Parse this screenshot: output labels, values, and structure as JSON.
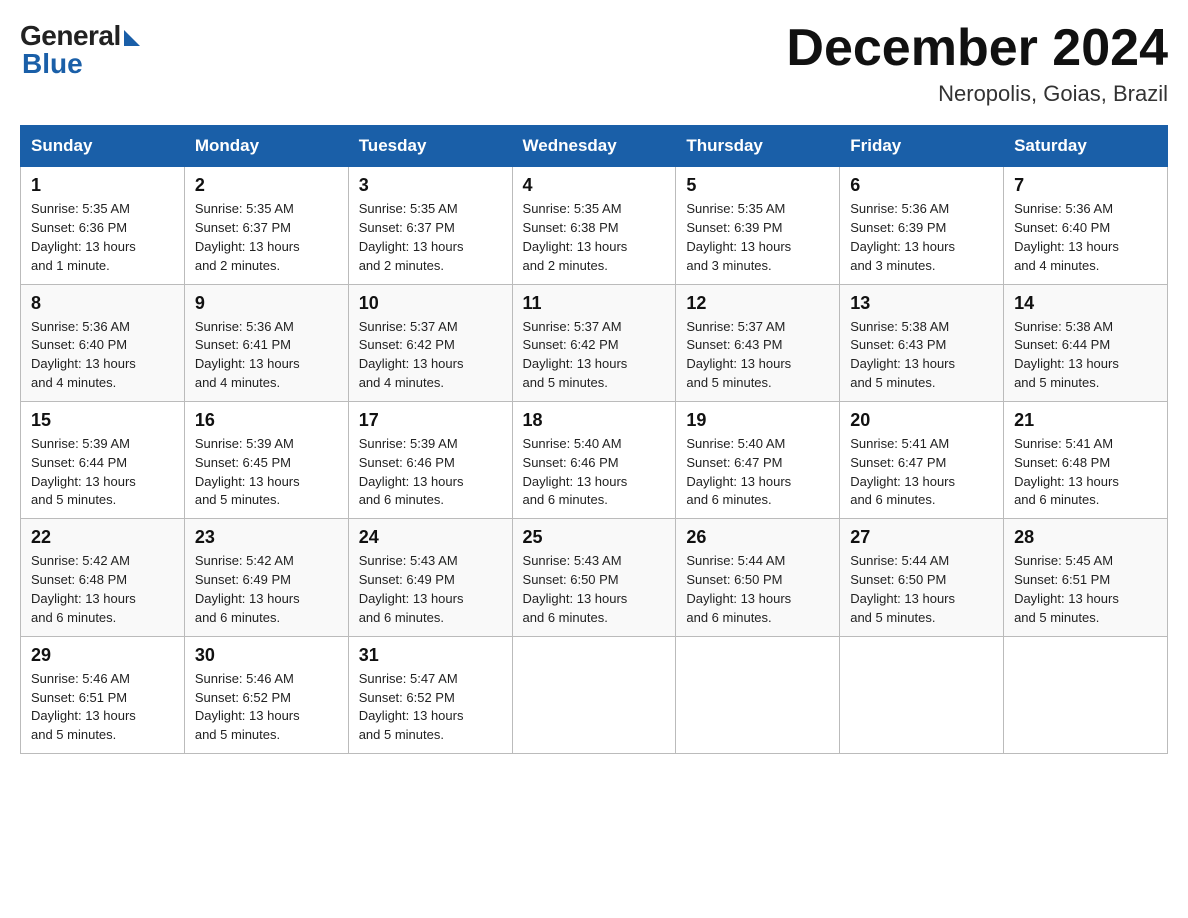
{
  "logo": {
    "text_general": "General",
    "text_blue": "Blue"
  },
  "header": {
    "month_title": "December 2024",
    "location": "Neropolis, Goias, Brazil"
  },
  "days_of_week": [
    "Sunday",
    "Monday",
    "Tuesday",
    "Wednesday",
    "Thursday",
    "Friday",
    "Saturday"
  ],
  "weeks": [
    [
      {
        "day": "1",
        "sunrise": "5:35 AM",
        "sunset": "6:36 PM",
        "daylight": "13 hours and 1 minute."
      },
      {
        "day": "2",
        "sunrise": "5:35 AM",
        "sunset": "6:37 PM",
        "daylight": "13 hours and 2 minutes."
      },
      {
        "day": "3",
        "sunrise": "5:35 AM",
        "sunset": "6:37 PM",
        "daylight": "13 hours and 2 minutes."
      },
      {
        "day": "4",
        "sunrise": "5:35 AM",
        "sunset": "6:38 PM",
        "daylight": "13 hours and 2 minutes."
      },
      {
        "day": "5",
        "sunrise": "5:35 AM",
        "sunset": "6:39 PM",
        "daylight": "13 hours and 3 minutes."
      },
      {
        "day": "6",
        "sunrise": "5:36 AM",
        "sunset": "6:39 PM",
        "daylight": "13 hours and 3 minutes."
      },
      {
        "day": "7",
        "sunrise": "5:36 AM",
        "sunset": "6:40 PM",
        "daylight": "13 hours and 4 minutes."
      }
    ],
    [
      {
        "day": "8",
        "sunrise": "5:36 AM",
        "sunset": "6:40 PM",
        "daylight": "13 hours and 4 minutes."
      },
      {
        "day": "9",
        "sunrise": "5:36 AM",
        "sunset": "6:41 PM",
        "daylight": "13 hours and 4 minutes."
      },
      {
        "day": "10",
        "sunrise": "5:37 AM",
        "sunset": "6:42 PM",
        "daylight": "13 hours and 4 minutes."
      },
      {
        "day": "11",
        "sunrise": "5:37 AM",
        "sunset": "6:42 PM",
        "daylight": "13 hours and 5 minutes."
      },
      {
        "day": "12",
        "sunrise": "5:37 AM",
        "sunset": "6:43 PM",
        "daylight": "13 hours and 5 minutes."
      },
      {
        "day": "13",
        "sunrise": "5:38 AM",
        "sunset": "6:43 PM",
        "daylight": "13 hours and 5 minutes."
      },
      {
        "day": "14",
        "sunrise": "5:38 AM",
        "sunset": "6:44 PM",
        "daylight": "13 hours and 5 minutes."
      }
    ],
    [
      {
        "day": "15",
        "sunrise": "5:39 AM",
        "sunset": "6:44 PM",
        "daylight": "13 hours and 5 minutes."
      },
      {
        "day": "16",
        "sunrise": "5:39 AM",
        "sunset": "6:45 PM",
        "daylight": "13 hours and 5 minutes."
      },
      {
        "day": "17",
        "sunrise": "5:39 AM",
        "sunset": "6:46 PM",
        "daylight": "13 hours and 6 minutes."
      },
      {
        "day": "18",
        "sunrise": "5:40 AM",
        "sunset": "6:46 PM",
        "daylight": "13 hours and 6 minutes."
      },
      {
        "day": "19",
        "sunrise": "5:40 AM",
        "sunset": "6:47 PM",
        "daylight": "13 hours and 6 minutes."
      },
      {
        "day": "20",
        "sunrise": "5:41 AM",
        "sunset": "6:47 PM",
        "daylight": "13 hours and 6 minutes."
      },
      {
        "day": "21",
        "sunrise": "5:41 AM",
        "sunset": "6:48 PM",
        "daylight": "13 hours and 6 minutes."
      }
    ],
    [
      {
        "day": "22",
        "sunrise": "5:42 AM",
        "sunset": "6:48 PM",
        "daylight": "13 hours and 6 minutes."
      },
      {
        "day": "23",
        "sunrise": "5:42 AM",
        "sunset": "6:49 PM",
        "daylight": "13 hours and 6 minutes."
      },
      {
        "day": "24",
        "sunrise": "5:43 AM",
        "sunset": "6:49 PM",
        "daylight": "13 hours and 6 minutes."
      },
      {
        "day": "25",
        "sunrise": "5:43 AM",
        "sunset": "6:50 PM",
        "daylight": "13 hours and 6 minutes."
      },
      {
        "day": "26",
        "sunrise": "5:44 AM",
        "sunset": "6:50 PM",
        "daylight": "13 hours and 6 minutes."
      },
      {
        "day": "27",
        "sunrise": "5:44 AM",
        "sunset": "6:50 PM",
        "daylight": "13 hours and 5 minutes."
      },
      {
        "day": "28",
        "sunrise": "5:45 AM",
        "sunset": "6:51 PM",
        "daylight": "13 hours and 5 minutes."
      }
    ],
    [
      {
        "day": "29",
        "sunrise": "5:46 AM",
        "sunset": "6:51 PM",
        "daylight": "13 hours and 5 minutes."
      },
      {
        "day": "30",
        "sunrise": "5:46 AM",
        "sunset": "6:52 PM",
        "daylight": "13 hours and 5 minutes."
      },
      {
        "day": "31",
        "sunrise": "5:47 AM",
        "sunset": "6:52 PM",
        "daylight": "13 hours and 5 minutes."
      },
      null,
      null,
      null,
      null
    ]
  ],
  "sunrise_label": "Sunrise:",
  "sunset_label": "Sunset:",
  "daylight_label": "Daylight:"
}
